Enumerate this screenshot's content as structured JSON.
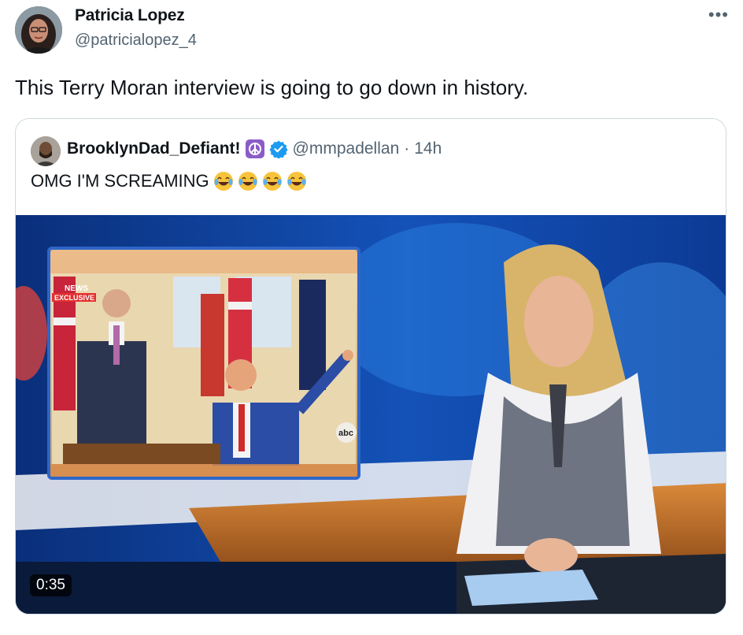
{
  "tweet": {
    "author_name": "Patricia Lopez",
    "author_handle": "@patricialopez_4",
    "more_icon": "more-icon",
    "text": "This Terry Moran interview is going to go down in history."
  },
  "quoted": {
    "author_name": "BrooklynDad_Defiant!",
    "author_handle": "@mmpadellan",
    "separator": "·",
    "timestamp": "14h",
    "text": "OMG I'M SCREAMING",
    "emoji": [
      "joy-emoji",
      "joy-emoji",
      "joy-emoji",
      "joy-emoji"
    ],
    "video": {
      "duration": "0:35",
      "inset_badge_1": "NEWS",
      "inset_badge_2": "EXCLUSIVE",
      "inset_logo": "abc"
    }
  },
  "colors": {
    "text": "#0f1419",
    "secondary": "#536471",
    "border": "#cfd9de",
    "verified": "#1d9bf0",
    "peace_badge": "#8b5cc8"
  }
}
